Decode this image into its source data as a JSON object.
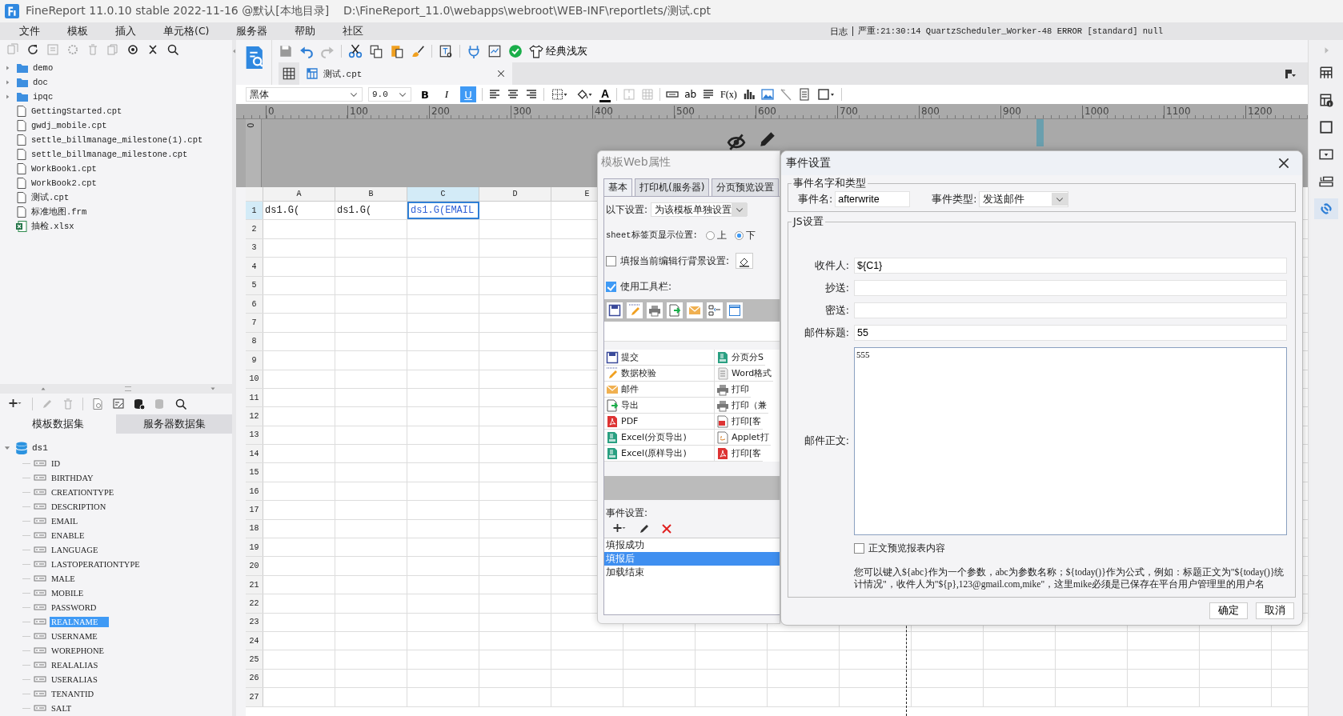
{
  "window": {
    "title": "FineReport 11.0.10 stable 2022-11-16 @默认[本地目录]",
    "path": "D:\\FineReport_11.0\\webapps\\webroot\\WEB-INF\\reportlets/测试.cpt"
  },
  "menu": [
    "文件",
    "模板",
    "插入",
    "单元格(C)",
    "服务器",
    "帮助",
    "社区"
  ],
  "log": {
    "label": "日志",
    "message": "严重:21:30:14 QuartzScheduler_Worker-48 ERROR [standard] null"
  },
  "file_tree": [
    {
      "name": "demo",
      "kind": "folder"
    },
    {
      "name": "doc",
      "kind": "folder"
    },
    {
      "name": "ipqc",
      "kind": "folder"
    },
    {
      "name": "GettingStarted.cpt",
      "kind": "file"
    },
    {
      "name": "gwdj_mobile.cpt",
      "kind": "file"
    },
    {
      "name": "settle_billmanage_milestone(1).cpt",
      "kind": "file"
    },
    {
      "name": "settle_billmanage_milestone.cpt",
      "kind": "file"
    },
    {
      "name": "WorkBook1.cpt",
      "kind": "file"
    },
    {
      "name": "WorkBook2.cpt",
      "kind": "file"
    },
    {
      "name": "测试.cpt",
      "kind": "file"
    },
    {
      "name": "标准地图.frm",
      "kind": "file"
    },
    {
      "name": "抽检.xlsx",
      "kind": "excel"
    }
  ],
  "dataset_tabs": [
    {
      "label": "模板数据集",
      "selected": true
    },
    {
      "label": "服务器数据集",
      "selected": false
    }
  ],
  "datasets": [
    {
      "name": "ds1",
      "expanded": true,
      "children": [
        {
          "name": "ID",
          "selected": false
        },
        {
          "name": "BIRTHDAY",
          "selected": false
        },
        {
          "name": "CREATIONTYPE",
          "selected": false
        },
        {
          "name": "DESCRIPTION",
          "selected": false
        },
        {
          "name": "EMAIL",
          "selected": false
        },
        {
          "name": "ENABLE",
          "selected": false
        },
        {
          "name": "LANGUAGE",
          "selected": false
        },
        {
          "name": "LASTOPERATIONTYPE",
          "selected": false
        },
        {
          "name": "MALE",
          "selected": false
        },
        {
          "name": "MOBILE",
          "selected": false
        },
        {
          "name": "PASSWORD",
          "selected": false
        },
        {
          "name": "REALNAME",
          "selected": true
        },
        {
          "name": "USERNAME",
          "selected": false
        },
        {
          "name": "WOREPHONE",
          "selected": false
        },
        {
          "name": "REALALIAS",
          "selected": false
        },
        {
          "name": "USERALIAS",
          "selected": false
        },
        {
          "name": "TENANTID",
          "selected": false
        },
        {
          "name": "SALT",
          "selected": false
        }
      ]
    }
  ],
  "toolbar": {
    "theme_label": "经典浅灰"
  },
  "document_tab": {
    "title": "测试.cpt"
  },
  "format_bar": {
    "font": "黑体",
    "size": "9.0",
    "style_buttons": [
      {
        "label": "B",
        "kind": "bold",
        "on": false
      },
      {
        "label": "I",
        "kind": "italic",
        "on": false
      },
      {
        "label": "U",
        "kind": "underline",
        "on": true
      }
    ],
    "font_color_label": "A",
    "text_label": "ab",
    "formula_label": "F(x)"
  },
  "ruler": {
    "vertical": "0",
    "ticks": [
      "0",
      "100",
      "200",
      "300",
      "400",
      "500",
      "600",
      "700",
      "800",
      "900",
      "1000",
      "1100",
      "1200"
    ]
  },
  "sheet": {
    "columns": [
      {
        "label": "A",
        "selected": false
      },
      {
        "label": "B",
        "selected": false
      },
      {
        "label": "C",
        "selected": true
      },
      {
        "label": "D",
        "selected": false
      },
      {
        "label": "E",
        "selected": false
      }
    ],
    "rows": [
      {
        "label": "1",
        "selected": true,
        "cells": [
          {
            "text": "ds1.G(",
            "selected": false
          },
          {
            "text": "ds1.G(",
            "selected": false
          },
          {
            "text": "ds1.G(EMAIL",
            "selected": true
          }
        ]
      },
      {
        "label": "2",
        "selected": false
      },
      {
        "label": "3",
        "selected": false
      },
      {
        "label": "4",
        "selected": false
      },
      {
        "label": "5",
        "selected": false
      },
      {
        "label": "6",
        "selected": false
      },
      {
        "label": "7",
        "selected": false
      },
      {
        "label": "8",
        "selected": false
      },
      {
        "label": "9",
        "selected": false
      },
      {
        "label": "10",
        "selected": false
      },
      {
        "label": "11",
        "selected": false
      },
      {
        "label": "12",
        "selected": false
      },
      {
        "label": "13",
        "selected": false
      },
      {
        "label": "14",
        "selected": false
      },
      {
        "label": "15",
        "selected": false
      },
      {
        "label": "16",
        "selected": false
      },
      {
        "label": "17",
        "selected": false
      },
      {
        "label": "18",
        "selected": false
      },
      {
        "label": "19",
        "selected": false
      },
      {
        "label": "20",
        "selected": false
      },
      {
        "label": "21",
        "selected": false
      },
      {
        "label": "22",
        "selected": false
      },
      {
        "label": "23",
        "selected": false
      },
      {
        "label": "24",
        "selected": false
      },
      {
        "label": "25",
        "selected": false
      },
      {
        "label": "26",
        "selected": false
      },
      {
        "label": "27",
        "selected": false
      }
    ]
  },
  "side_tools": [
    {
      "kind": "cell",
      "selected": false
    },
    {
      "kind": "info",
      "selected": false
    },
    {
      "kind": "frame",
      "selected": false
    },
    {
      "kind": "widget",
      "selected": false
    },
    {
      "kind": "condition",
      "selected": false
    },
    {
      "kind": "link",
      "selected": true
    }
  ],
  "web_dialog": {
    "title": "模板Web属性",
    "tabs": [
      {
        "label": "基本",
        "selected": true
      },
      {
        "label": "打印机(服务器)",
        "selected": false
      },
      {
        "label": "分页预览设置",
        "selected": false
      }
    ],
    "scope_label": "以下设置:",
    "scope_value": "为该模板单独设置",
    "sheet_position": {
      "label": "sheet标签页显示位置:",
      "options": [
        {
          "label": "上",
          "selected": false
        },
        {
          "label": "下",
          "selected": true
        }
      ]
    },
    "row_background": {
      "label": "填报当前编辑行背景设置:",
      "checked": false
    },
    "use_toolbar": {
      "label": "使用工具栏:",
      "checked": true
    },
    "toolbar_buttons": [
      [
        {
          "label": "提交",
          "kind": "submit"
        },
        {
          "label": "分页分S",
          "kind": "excel"
        }
      ],
      [
        {
          "label": "数据校验",
          "kind": "verify"
        },
        {
          "label": "Word格式",
          "kind": "word"
        }
      ],
      [
        {
          "label": "邮件",
          "kind": "mail"
        },
        {
          "label": "打印",
          "kind": "print"
        }
      ],
      [
        {
          "label": "导出",
          "kind": "export"
        },
        {
          "label": "打印（兼",
          "kind": "print"
        }
      ],
      [
        {
          "label": "PDF",
          "kind": "pdf"
        },
        {
          "label": "打印[客",
          "kind": "flash"
        }
      ],
      [
        {
          "label": "Excel(分页导出)",
          "kind": "excel"
        },
        {
          "label": "Applet打",
          "kind": "applet"
        }
      ],
      [
        {
          "label": "Excel(原样导出)",
          "kind": "excel"
        },
        {
          "label": "打印[客",
          "kind": "pdf"
        }
      ]
    ],
    "events_label": "事件设置:",
    "events": [
      {
        "label": "填报成功",
        "selected": false
      },
      {
        "label": "填报后",
        "selected": true
      },
      {
        "label": "加载结束",
        "selected": false
      }
    ]
  },
  "event_dialog": {
    "title": "事件设置",
    "name_group": "事件名字和类型",
    "name_label": "事件名:",
    "name_value": "afterwrite",
    "type_label": "事件类型:",
    "type_value": "发送邮件",
    "js_group": "JS设置",
    "fields": [
      {
        "label": "收件人:",
        "value": "${C1}"
      },
      {
        "label": "抄送:"
      },
      {
        "label": "密送:"
      },
      {
        "label": "邮件标题:",
        "value": "55"
      }
    ],
    "body_label": "邮件正文:",
    "body_value": "555",
    "preview": {
      "label": "正文预览报表内容",
      "checked": false
    },
    "hint": "您可以键入${abc}作为一个参数，abc为参数名称；${today()}作为公式，例如：标题正文为\"${today()}统计情况\"，收件人为\"${p},123@gmail.com,mike\"，这里mike必须是已保存在平台用户管理里的用户名",
    "buttons": [
      "确定",
      "取消"
    ]
  }
}
